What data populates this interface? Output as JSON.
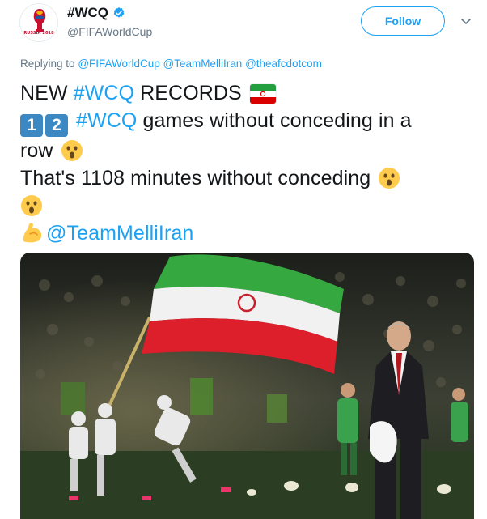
{
  "account": {
    "display_name": "#WCQ",
    "handle": "@FIFAWorldCup",
    "avatar_label": "RUSSIA 2018"
  },
  "follow_label": "Follow",
  "reply": {
    "prefix": "Replying to",
    "mentions": [
      "@FIFAWorldCup",
      "@TeamMelliIran",
      "@theafcdotcom"
    ]
  },
  "tweet": {
    "line1_pre": "NEW ",
    "line1_hashtag": "#WCQ",
    "line1_post": " RECORDS",
    "line2_keycap_1": "1",
    "line2_keycap_2": "2",
    "line2_hashtag": "#WCQ",
    "line2_post": " games without conceding in a",
    "line3": "row",
    "line4": "That's 1108 minutes without conceding",
    "mention": "@TeamMelliIran"
  },
  "colors": {
    "link": "#1da1f2",
    "secondary_text": "#657786",
    "primary_text": "#14171a"
  },
  "icons": [
    "verified-badge-icon",
    "chevron-down-icon",
    "iran-flag-emoji",
    "astonished-face-emoji",
    "flexed-biceps-emoji",
    "keycap-digit-emoji"
  ]
}
